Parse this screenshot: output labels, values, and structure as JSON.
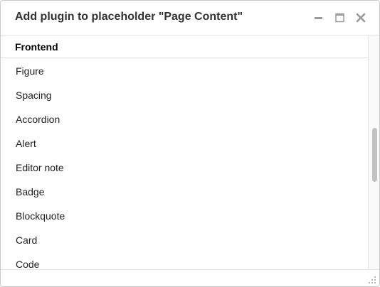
{
  "dialog": {
    "title": "Add plugin to placeholder \"Page Content\"",
    "controls": {
      "minimize_icon": "minimize-icon",
      "maximize_icon": "maximize-icon",
      "close_icon": "close-icon"
    }
  },
  "section": {
    "header": "Frontend"
  },
  "plugins": [
    "Figure",
    "Spacing",
    "Accordion",
    "Alert",
    "Editor note",
    "Badge",
    "Blockquote",
    "Card",
    "Code"
  ],
  "colors": {
    "title_text": "#333333",
    "icon_gray": "#9a9a9a",
    "scroll_thumb": "#c1c1c1"
  }
}
